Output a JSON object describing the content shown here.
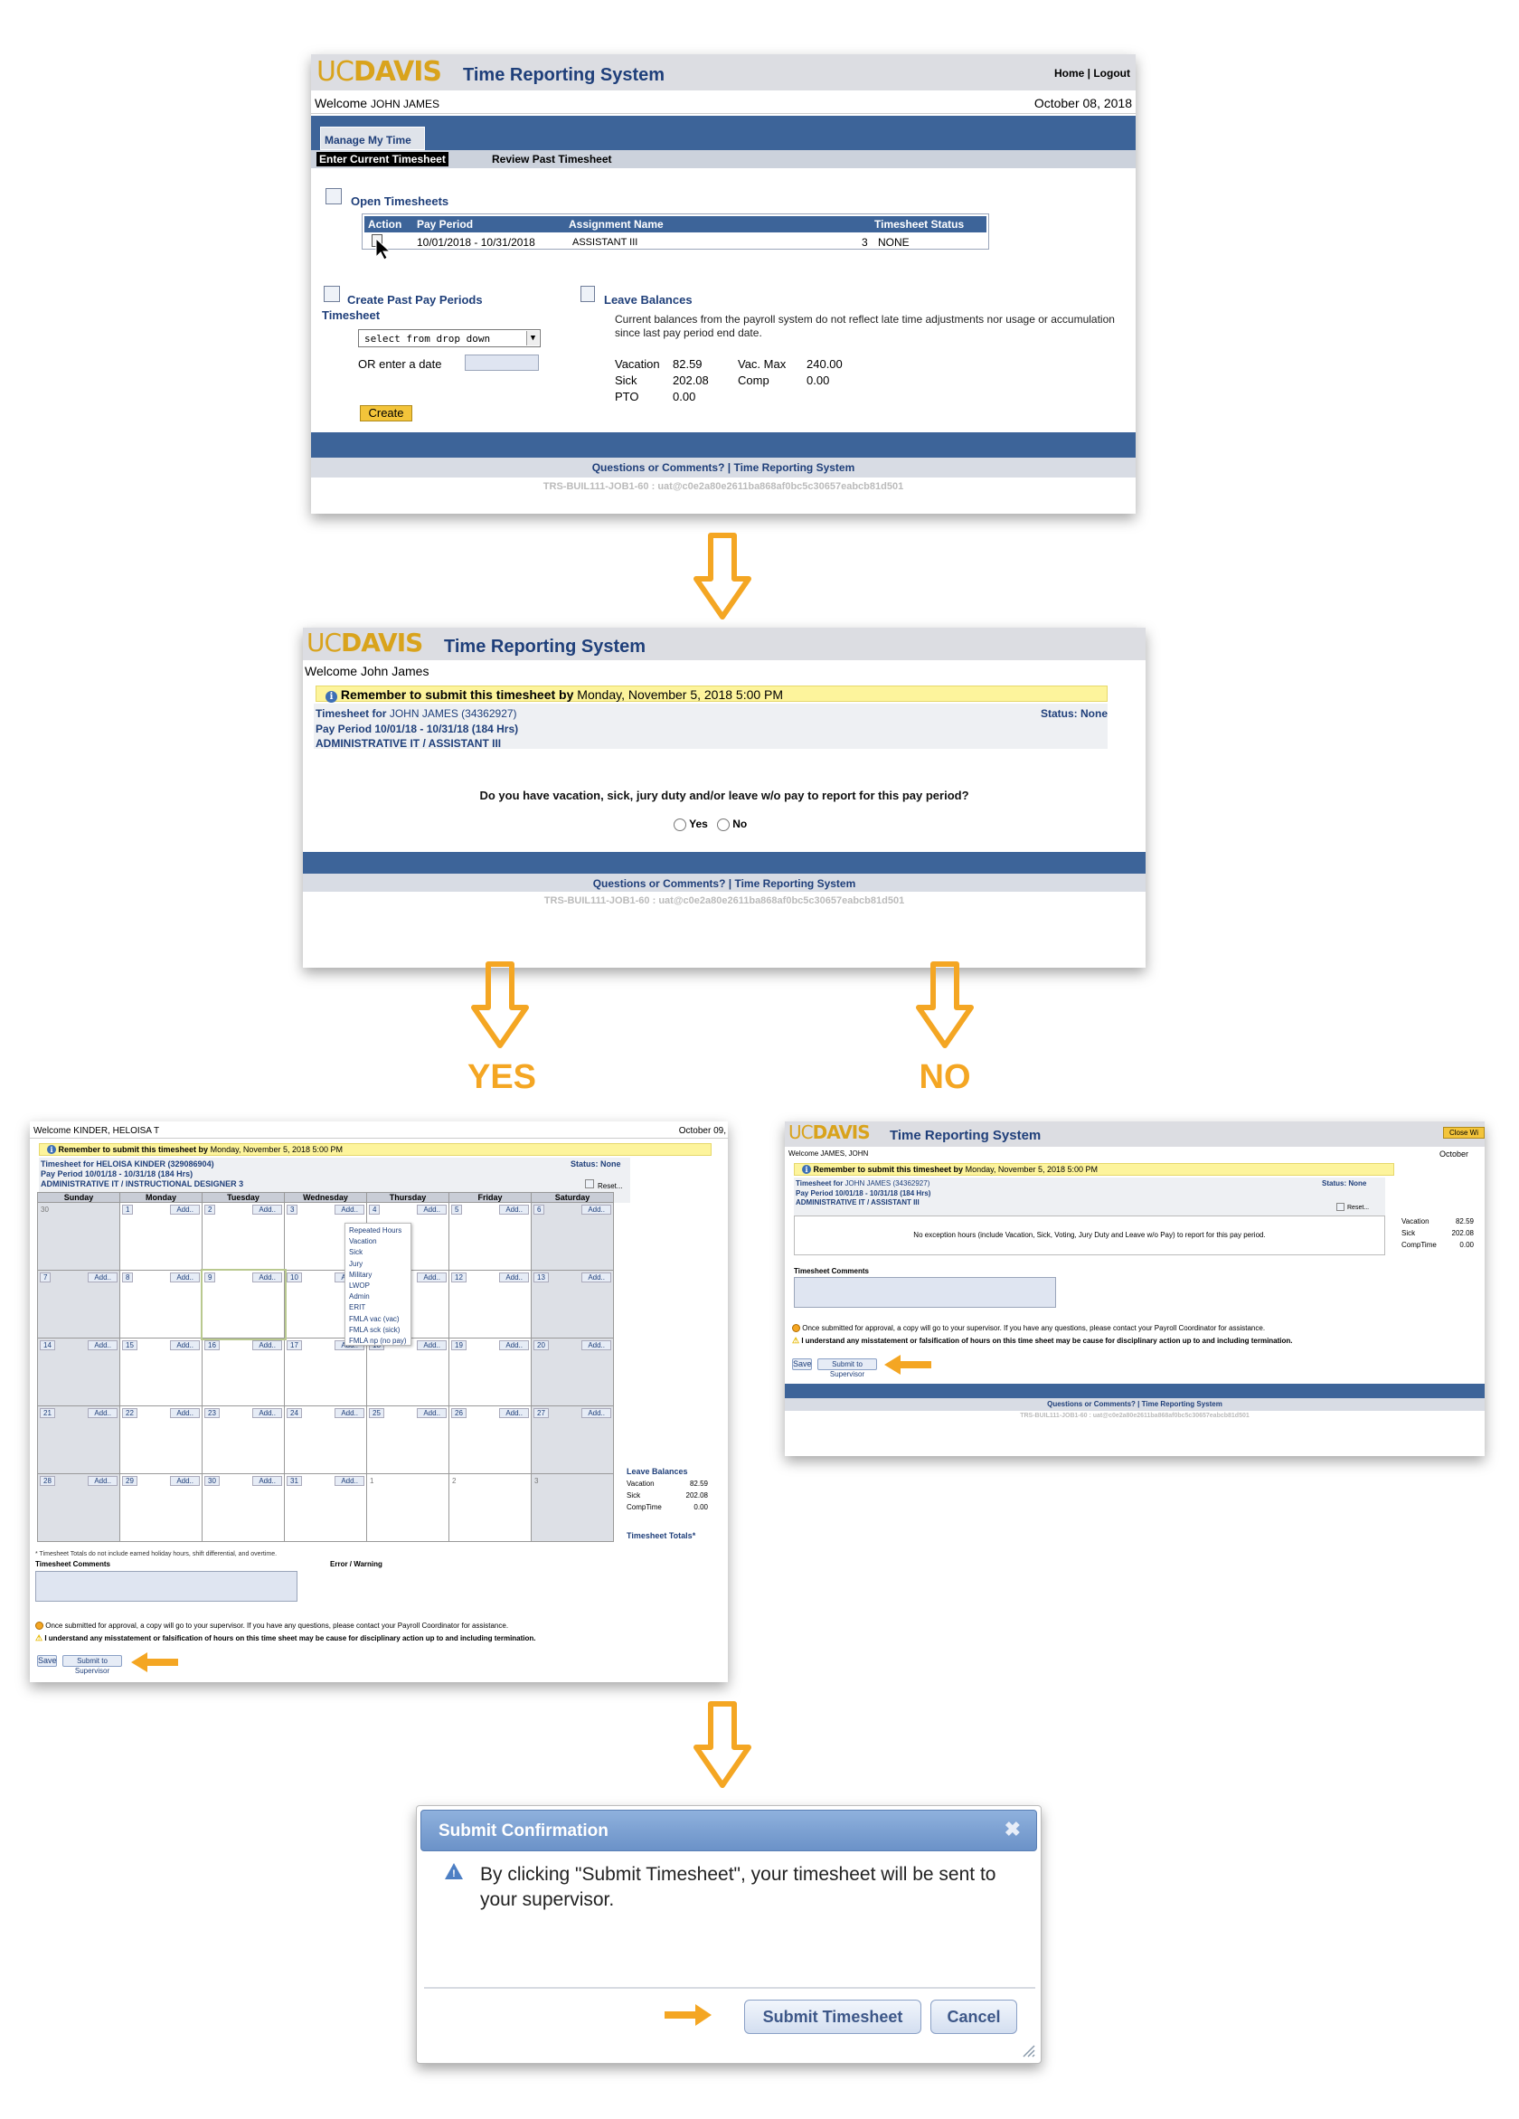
{
  "screen1": {
    "logo_uc": "UC",
    "logo_davis": "DAVIS",
    "app_title": "Time Reporting System",
    "nav_home": "Home",
    "nav_sep": "|",
    "nav_logout": "Logout",
    "welcome": "Welcome",
    "user": "JOHN JAMES",
    "date": "October 08, 2018",
    "tab_manage": "Manage My Time",
    "subtab_current": "Enter Current Timesheet",
    "subtab_past": "Review Past Timesheet",
    "open_timesheets": "Open Timesheets",
    "table_headers": [
      "Action",
      "Pay Period",
      "Assignment Name",
      "Timesheet Status"
    ],
    "row": {
      "pay_period": "10/01/2018 - 10/31/2018",
      "assignment": "ASSISTANT III",
      "count": "3",
      "status": "NONE"
    },
    "create_past_1": "Create Past Pay Periods",
    "create_past_2": "Timesheet",
    "dropdown": "select from drop down",
    "or_date": "OR enter a date",
    "create_btn": "Create",
    "leave_balances": "Leave Balances",
    "leave_note": "Current balances from the payroll system do not reflect late time adjustments nor usage or accumulation since last pay period end date.",
    "bal": {
      "vacation_label": "Vacation",
      "vacation": "82.59",
      "vacmax_label": "Vac. Max",
      "vacmax": "240.00",
      "sick_label": "Sick",
      "sick": "202.08",
      "comp_label": "Comp",
      "comp": "0.00",
      "pto_label": "PTO",
      "pto": "0.00"
    },
    "footer_q": "Questions or Comments?",
    "footer_sep": "|",
    "footer_trs": "Time Reporting System",
    "footer_id": "TRS-BUIL111-JOB1-60 : uat@c0e2a80e2611ba868af0bc5c30657eabcb81d501"
  },
  "screen2": {
    "logo_uc": "UC",
    "logo_davis": "DAVIS",
    "app_title": "Time Reporting System",
    "welcome": "Welcome John James",
    "banner_bold": "Remember to submit this timesheet by",
    "banner_date": "Monday, November 5, 2018 5:00 PM",
    "ts_for_label": "Timesheet for",
    "ts_for_name": "JOHN JAMES (34362927)",
    "status": "Status: None",
    "pay_period": "Pay Period 10/01/18 - 10/31/18 (184 Hrs)",
    "assignment": "ADMINISTRATIVE IT / ASSISTANT III",
    "question": "Do you have vacation, sick, jury duty and/or leave w/o pay to report for this pay period?",
    "yes": "Yes",
    "no": "No",
    "footer_q": "Questions or Comments?",
    "footer_sep": "|",
    "footer_trs": "Time Reporting System",
    "footer_id": "TRS-BUIL111-JOB1-60 : uat@c0e2a80e2611ba868af0bc5c30657eabcb81d501"
  },
  "labels": {
    "yes": "YES",
    "no": "NO"
  },
  "screen3": {
    "welcome": "Welcome KINDER, HELOISA T",
    "date": "October 09,",
    "banner_bold": "Remember to submit this timesheet by",
    "banner_date": "Monday, November 5, 2018 5:00 PM",
    "ts_for": "Timesheet for HELOISA KINDER (329086904)",
    "status": "Status: None",
    "pay_period": "Pay Period 10/01/18 - 10/31/18 (184 Hrs)",
    "assignment": "ADMINISTRATIVE IT / INSTRUCTIONAL DESIGNER 3",
    "reset": "Reset...",
    "days": [
      "Sunday",
      "Monday",
      "Tuesday",
      "Wednesday",
      "Thursday",
      "Friday",
      "Saturday"
    ],
    "weeks": [
      [
        "30",
        "1",
        "2",
        "3",
        "4",
        "5",
        "6"
      ],
      [
        "7",
        "8",
        "9",
        "10",
        "11",
        "12",
        "13"
      ],
      [
        "14",
        "15",
        "16",
        "17",
        "18",
        "19",
        "20"
      ],
      [
        "21",
        "22",
        "23",
        "24",
        "25",
        "26",
        "27"
      ],
      [
        "28",
        "29",
        "30",
        "31",
        "1",
        "2",
        "3"
      ]
    ],
    "add": "Add..",
    "menu": [
      "Repeated Hours",
      "Vacation",
      "Sick",
      "Jury",
      "Military",
      "LWOP",
      "Admin",
      "ERIT",
      "FMLA vac (vac)",
      "FMLA sck (sick)",
      "FMLA np (no pay)"
    ],
    "leave_balances": "Leave Balances",
    "bal": [
      [
        "Vacation",
        "82.59"
      ],
      [
        "Sick",
        "202.08"
      ],
      [
        "CompTime",
        "0.00"
      ]
    ],
    "totals": "Timesheet Totals*",
    "totals_note": "* Timesheet Totals do not include earned holiday hours, shift differential, and overtime.",
    "comments": "Timesheet Comments",
    "error": "Error / Warning",
    "approval_note": "Once submitted for approval, a copy will go to your supervisor. If you have any questions, please contact your Payroll Coordinator for assistance.",
    "warning_note": "I understand any misstatement or falsification of hours on this time sheet may be cause for disciplinary action up to and including termination.",
    "save": "Save",
    "submit": "Submit to Supervisor"
  },
  "screen4": {
    "logo_uc": "UC",
    "logo_davis": "DAVIS",
    "app_title": "Time Reporting System",
    "close_btn": "Close Wi",
    "welcome": "Welcome JAMES, JOHN",
    "date": "October",
    "banner_bold": "Remember to submit this timesheet by",
    "banner_date": "Monday, November 5, 2018 5:00 PM",
    "ts_for_label": "Timesheet for",
    "ts_for_name": "JOHN JAMES (34362927)",
    "status": "Status: None",
    "pay_period": "Pay Period 10/01/18 - 10/31/18 (184 Hrs)",
    "assignment": "ADMINISTRATIVE IT / ASSISTANT III",
    "reset": "Reset...",
    "no_exception": "No exception hours (include Vacation, Sick, Voting, Jury Duty and Leave w/o Pay) to report for this pay period.",
    "bal": [
      [
        "Vacation",
        "82.59"
      ],
      [
        "Sick",
        "202.08"
      ],
      [
        "CompTime",
        "0.00"
      ]
    ],
    "comments": "Timesheet Comments",
    "approval_note": "Once submitted for approval, a copy will go to your supervisor. If you have any questions, please contact your Payroll Coordinator for assistance.",
    "warning_note": "I understand any misstatement or falsification of hours on this time sheet may be cause for disciplinary action up to and including termination.",
    "save": "Save",
    "submit": "Submit to Supervisor",
    "footer_q": "Questions or Comments?",
    "footer_sep": "|",
    "footer_trs": "Time Reporting System",
    "footer_id": "TRS-BUIL111-JOB1-60 : uat@c0e2a80e2611ba868af0bc5c30657eabcb81d501"
  },
  "dialog": {
    "title": "Submit Confirmation",
    "message": "By clicking \"Submit Timesheet\", your timesheet will be sent to your supervisor.",
    "submit": "Submit Timesheet",
    "cancel": "Cancel"
  },
  "colors": {
    "navy": "#1f3f7a",
    "gold": "#d9a31c",
    "arrow": "#f4a623",
    "bar": "#3d6499",
    "banner": "#fdf49c"
  }
}
